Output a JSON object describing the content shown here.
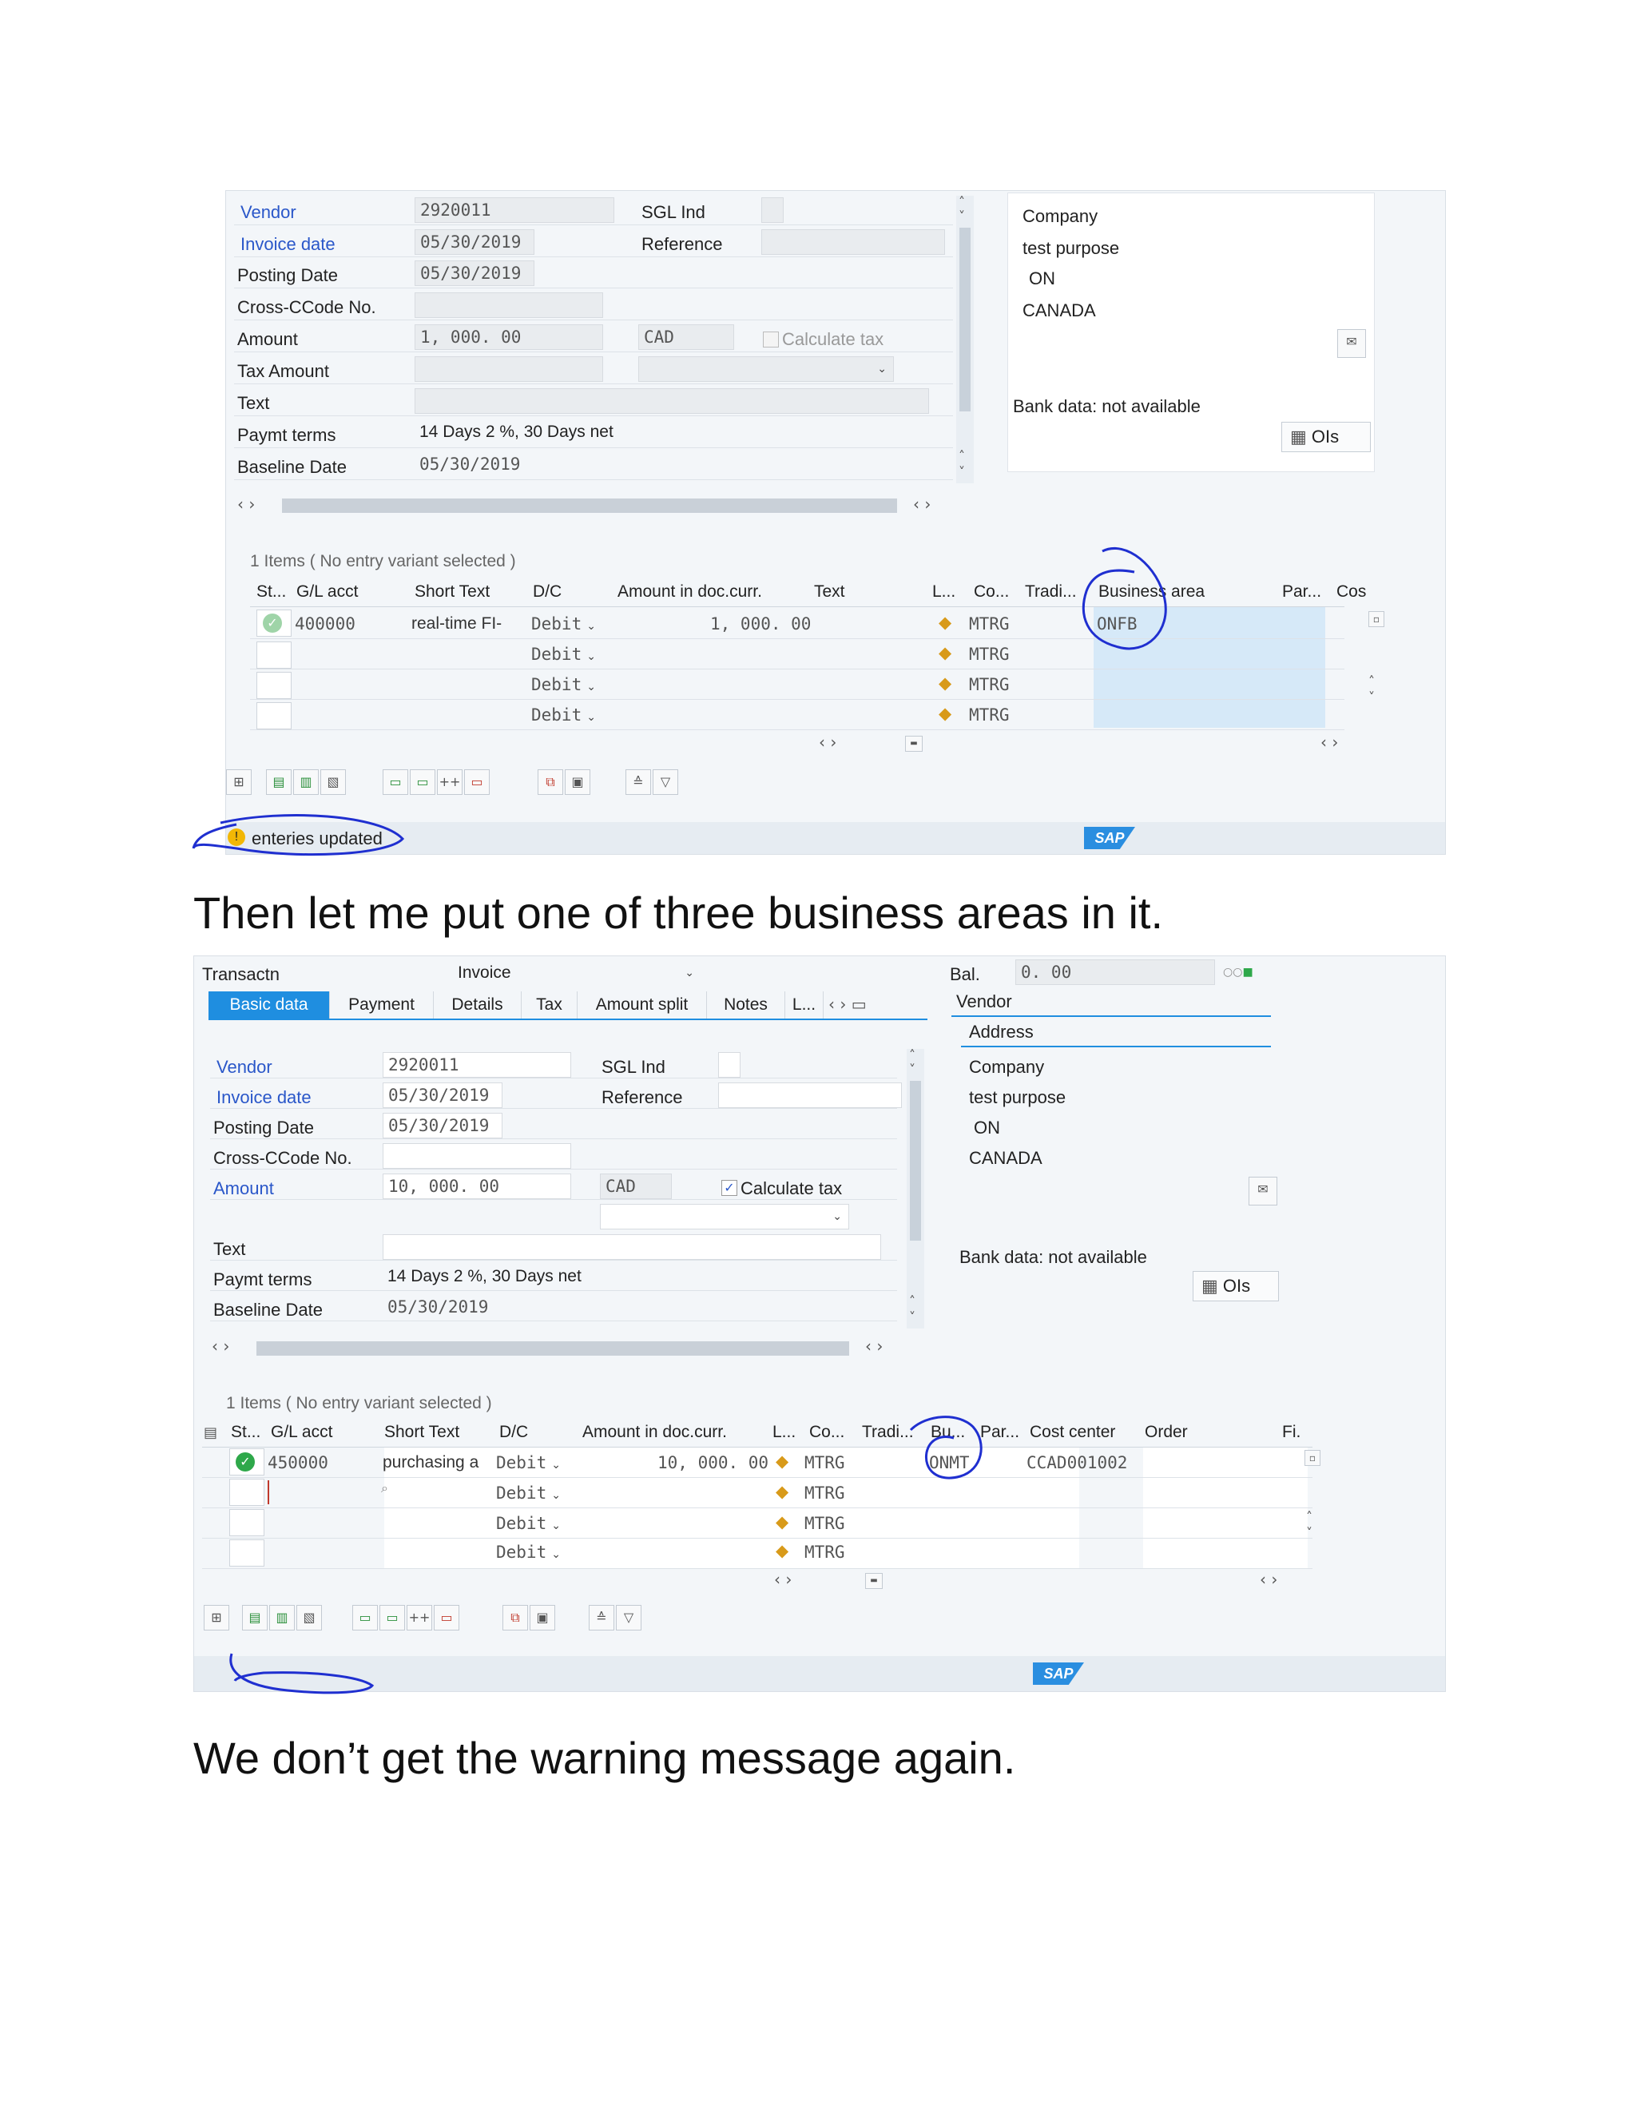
{
  "shot1": {
    "header": {
      "vendor_label": "Vendor",
      "vendor_value": "2920011",
      "sgl_label": "SGL Ind",
      "invoice_date_label": "Invoice date",
      "invoice_date_value": "05/30/2019",
      "reference_label": "Reference",
      "posting_date_label": "Posting Date",
      "posting_date_value": "05/30/2019",
      "cross_ccode_label": "Cross-CCode No.",
      "amount_label": "Amount",
      "amount_value": "1, 000. 00",
      "currency": "CAD",
      "calculate_tax_label": "Calculate tax",
      "calculate_tax_checked": false,
      "tax_amount_label": "Tax Amount",
      "text_label": "Text",
      "paymt_terms_label": "Paymt terms",
      "paymt_terms_value": "14 Days 2 %, 30 Days net",
      "baseline_date_label": "Baseline Date",
      "baseline_date_value": "05/30/2019"
    },
    "vendor_panel": {
      "lines": [
        "Company",
        "test purpose",
        "ON",
        "CANADA"
      ],
      "bank_data": "Bank data: not available",
      "ois_button": "OIs"
    },
    "items": {
      "count_text": "1 Items ( No entry variant selected )",
      "columns": [
        "St...",
        "G/L acct",
        "Short Text",
        "D/C",
        "Amount in doc.curr.",
        "Text",
        "L...",
        "Co...",
        "Tradi...",
        "Business area",
        "Par...",
        "Cos"
      ],
      "rows": [
        {
          "gl": "400000",
          "short_text": "real-time FI-",
          "dc": "Debit",
          "amount": "1, 000. 00",
          "co": "MTRG",
          "business_area": "ONFB"
        },
        {
          "gl": "",
          "short_text": "",
          "dc": "Debit",
          "amount": "",
          "co": "MTRG",
          "business_area": ""
        },
        {
          "gl": "",
          "short_text": "",
          "dc": "Debit",
          "amount": "",
          "co": "MTRG",
          "business_area": ""
        },
        {
          "gl": "",
          "short_text": "",
          "dc": "Debit",
          "amount": "",
          "co": "MTRG",
          "business_area": ""
        }
      ]
    },
    "status_message": "enteries updated",
    "sap_logo": "SAP"
  },
  "caption1": "Then let me put one of three business areas in it.",
  "shot2": {
    "transactn_label": "Transactn",
    "transactn_value": "Invoice",
    "bal_label": "Bal.",
    "bal_value": "0. 00",
    "tabs": [
      "Basic data",
      "Payment",
      "Details",
      "Tax",
      "Amount split",
      "Notes",
      "L..."
    ],
    "vendor_tab": "Vendor",
    "address_tab": "Address",
    "header": {
      "vendor_label": "Vendor",
      "vendor_value": "2920011",
      "sgl_label": "SGL Ind",
      "invoice_date_label": "Invoice date",
      "invoice_date_value": "05/30/2019",
      "reference_label": "Reference",
      "posting_date_label": "Posting Date",
      "posting_date_value": "05/30/2019",
      "cross_ccode_label": "Cross-CCode No.",
      "amount_label": "Amount",
      "amount_value": "10, 000. 00",
      "currency": "CAD",
      "calculate_tax_label": "Calculate tax",
      "calculate_tax_checked": true,
      "text_label": "Text",
      "paymt_terms_label": "Paymt terms",
      "paymt_terms_value": "14 Days 2 %, 30 Days net",
      "baseline_date_label": "Baseline Date",
      "baseline_date_value": "05/30/2019"
    },
    "vendor_panel": {
      "lines": [
        "Company",
        "test purpose",
        "ON",
        "CANADA"
      ],
      "bank_data": "Bank data: not available",
      "ois_button": "OIs"
    },
    "items": {
      "count_text": "1 Items ( No entry variant selected )",
      "columns": [
        "St...",
        "G/L acct",
        "Short Text",
        "D/C",
        "Amount in doc.curr.",
        "L...",
        "Co...",
        "Tradi...",
        "Bu...",
        "Par...",
        "Cost center",
        "Order",
        "Fi."
      ],
      "rows": [
        {
          "gl": "450000",
          "short_text": "purchasing a",
          "dc": "Debit",
          "amount": "10, 000. 00",
          "co": "MTRG",
          "bu": "ONMT",
          "cost_center": "CCAD001002"
        },
        {
          "gl": "",
          "short_text": "",
          "dc": "Debit",
          "amount": "",
          "co": "MTRG",
          "bu": "",
          "cost_center": ""
        },
        {
          "gl": "",
          "short_text": "",
          "dc": "Debit",
          "amount": "",
          "co": "MTRG",
          "bu": "",
          "cost_center": ""
        },
        {
          "gl": "",
          "short_text": "",
          "dc": "Debit",
          "amount": "",
          "co": "MTRG",
          "bu": "",
          "cost_center": ""
        }
      ]
    },
    "sap_logo": "SAP"
  },
  "caption2": "We don’t get the warning message again.",
  "colors": {
    "accent": "#1f8ee0",
    "label_blue": "#2a57c9",
    "annotation": "#1f2fd0",
    "ok_green": "#2ea84a"
  },
  "icons": [
    "scroll-up-icon",
    "scroll-down-icon",
    "scroll-left-icon",
    "scroll-right-icon",
    "check-icon",
    "warning-icon",
    "dropdown-icon",
    "person-card-icon",
    "calculator-icon",
    "toolbar-icons"
  ]
}
